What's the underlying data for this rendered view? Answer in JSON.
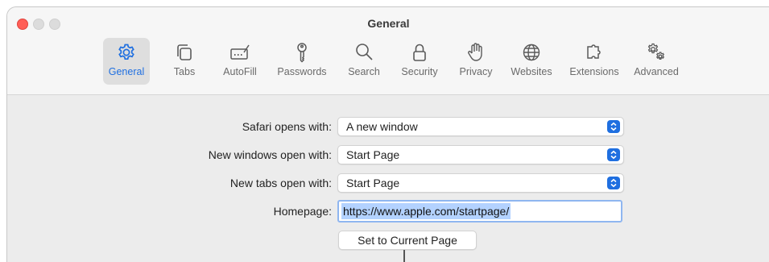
{
  "window": {
    "title": "General"
  },
  "tabs": [
    {
      "label": "General",
      "icon": "gear-icon",
      "active": true
    },
    {
      "label": "Tabs",
      "icon": "tabs-icon",
      "active": false
    },
    {
      "label": "AutoFill",
      "icon": "autofill-icon",
      "active": false
    },
    {
      "label": "Passwords",
      "icon": "key-icon",
      "active": false
    },
    {
      "label": "Search",
      "icon": "search-icon",
      "active": false
    },
    {
      "label": "Security",
      "icon": "lock-icon",
      "active": false
    },
    {
      "label": "Privacy",
      "icon": "hand-icon",
      "active": false
    },
    {
      "label": "Websites",
      "icon": "globe-icon",
      "active": false
    },
    {
      "label": "Extensions",
      "icon": "puzzle-icon",
      "active": false
    },
    {
      "label": "Advanced",
      "icon": "gears-icon",
      "active": false
    }
  ],
  "settings": {
    "safari_opens": {
      "label": "Safari opens with:",
      "value": "A new window"
    },
    "new_windows": {
      "label": "New windows open with:",
      "value": "Start Page"
    },
    "new_tabs": {
      "label": "New tabs open with:",
      "value": "Start Page"
    },
    "homepage": {
      "label": "Homepage:",
      "value": "https://www.apple.com/startpage/"
    },
    "set_current": {
      "label": "Set to Current Page"
    }
  },
  "colors": {
    "accent": "#1f6fe0",
    "close": "#ff5f57",
    "selection": "#b3d2ff"
  }
}
